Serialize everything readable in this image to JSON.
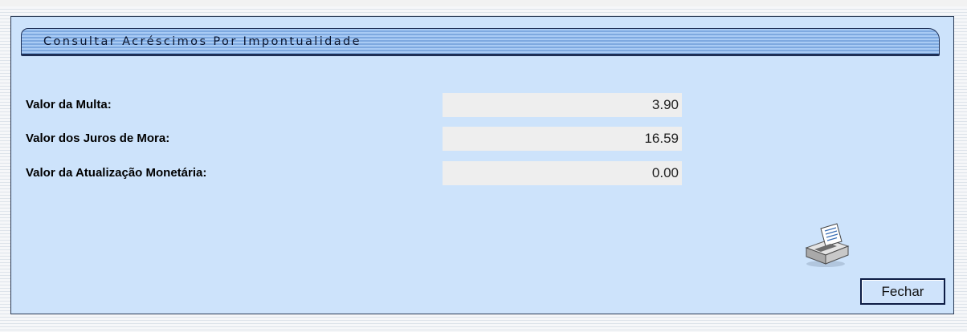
{
  "window": {
    "title": "Consultar Acréscimos Por Impontualidade"
  },
  "fields": [
    {
      "label": "Valor da Multa:",
      "value": "3.90"
    },
    {
      "label": "Valor dos Juros de Mora:",
      "value": "16.59"
    },
    {
      "label": "Valor da Atualização Monetária:",
      "value": "0.00"
    }
  ],
  "actions": {
    "print_icon": "printer-icon",
    "close_label": "Fechar"
  },
  "colors": {
    "panel_background": "#cde3fb",
    "title_bar": "#8db8ea",
    "field_background": "#eeeeee",
    "border": "#1e2f55"
  }
}
